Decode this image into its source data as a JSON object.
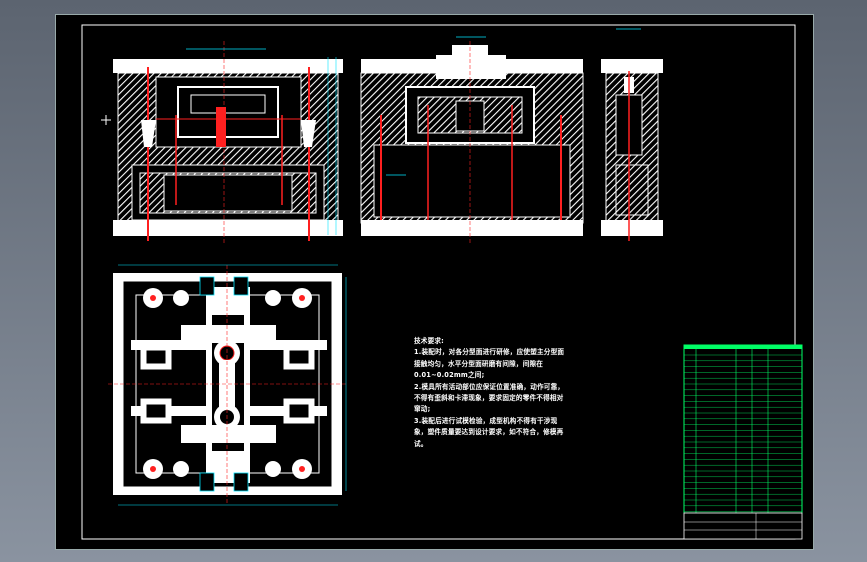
{
  "drawing": {
    "section_label_1": "",
    "section_label_2": "",
    "section_label_3": ""
  },
  "tech_requirements": {
    "title": "技术要求:",
    "lines": [
      "1.装配时，对各分型面进行研修，应使塑主分型面",
      "接触均匀，水平分型面研磨有间隙，间隙在",
      "0.01~0.02mm之间;",
      "2.模具所有活动部位应保证位置准确，动作可靠，",
      "不得有歪斜和卡滞现象，要求固定的零件不得相对",
      "窜动;",
      "3.装配后进行试模检验，成型机构不得有干涉现",
      "象，塑件质量要达到设计要求，如不符合，修模再",
      "试。"
    ]
  },
  "colors": {
    "line": "#ffffff",
    "hatch": "#ffffff",
    "accent_red": "#ff2020",
    "dimension": "#00e5ff",
    "table_green": "#00ff66",
    "background": "#000000"
  }
}
